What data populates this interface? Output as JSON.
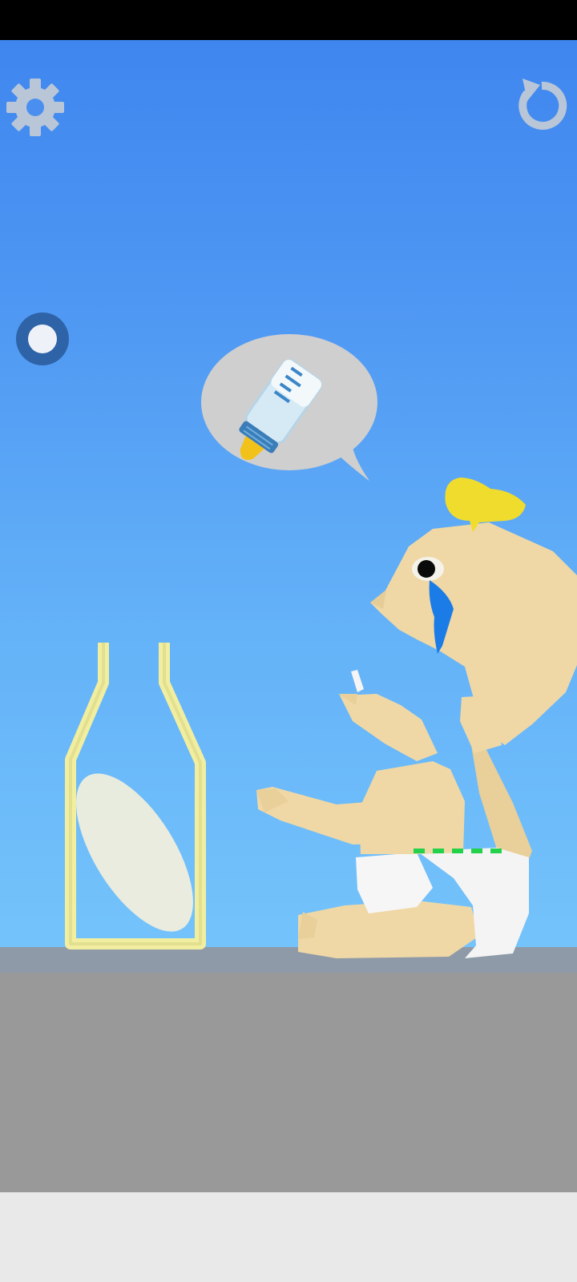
{
  "hud": {
    "settings_icon": "gear-icon",
    "restart_icon": "restart-icon",
    "toggle_icon": "radio-toggle-icon"
  },
  "scene": {
    "thought_bubble_icon": "baby-bottle-icon",
    "bottle": "bottle-outline",
    "character": "crying-baby"
  },
  "colors": {
    "sky_top": "#3f86ef",
    "sky_bottom": "#74c3fb",
    "ground": "#999999",
    "bottle_outline": "#f1eea0",
    "skin": "#efd8a6",
    "hair": "#f0dc2c",
    "tear": "#1b7ce8",
    "hud_icon": "#b8c6d8"
  }
}
